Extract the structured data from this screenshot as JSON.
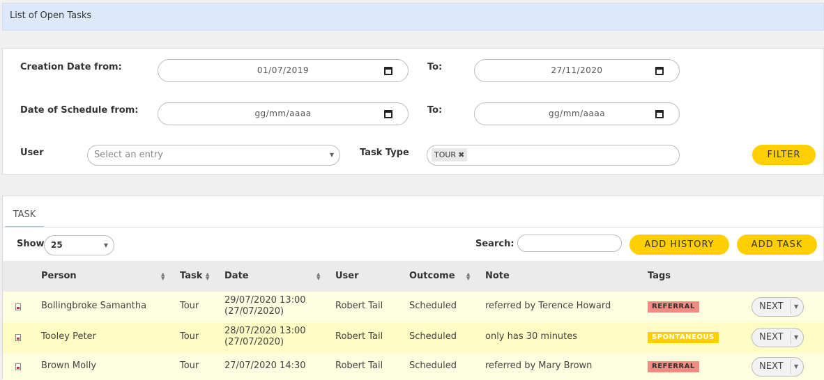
{
  "header": {
    "title": "List of Open Tasks"
  },
  "filters": {
    "creation_from_label": "Creation Date from:",
    "creation_from_value": "01/07/2019",
    "creation_to_label": "To:",
    "creation_to_value": "27/11/2020",
    "schedule_from_label": "Date of Schedule from:",
    "schedule_from_value": "gg/mm/aaaa",
    "schedule_to_label": "To:",
    "schedule_to_value": "gg/mm/aaaa",
    "user_label": "User",
    "user_placeholder": "Select an entry",
    "task_type_label": "Task Type",
    "task_type_chip": "TOUR",
    "filter_button": "FILTER"
  },
  "tasks": {
    "tab_label": "TASK",
    "show_label": "Show",
    "show_value": "25",
    "search_label": "Search:",
    "add_history_button": "ADD HISTORY",
    "add_task_button": "ADD TASK",
    "columns": [
      "Person",
      "Task",
      "Date",
      "User",
      "Outcome",
      "Note",
      "Tags"
    ],
    "rows": [
      {
        "person": "Bollingbroke Samantha",
        "task": "Tour",
        "date": "29/07/2020 13:00",
        "date_sub": "(27/07/2020)",
        "user": "Robert Tail",
        "outcome": "Scheduled",
        "note": "referred by Terence Howard",
        "tag": "REFERRAL",
        "action": "NEXT"
      },
      {
        "person": "Tooley Peter",
        "task": "Tour",
        "date": "28/07/2020 13:00",
        "date_sub": "(27/07/2020)",
        "user": "Robert Tail",
        "outcome": "Scheduled",
        "note": "only has 30 minutes",
        "tag": "SPONTANEOUS",
        "action": "NEXT"
      },
      {
        "person": "Brown Molly",
        "task": "Tour",
        "date": "27/07/2020 14:30",
        "date_sub": "",
        "user": "Robert Tail",
        "outcome": "Scheduled",
        "note": "referred by Mary Brown",
        "tag": "REFERRAL",
        "action": "NEXT"
      }
    ],
    "colors": {
      "accent_yellow": "#ffcf00",
      "referral_badge": "#f28b82",
      "header_blue": "#dde9fb"
    }
  }
}
